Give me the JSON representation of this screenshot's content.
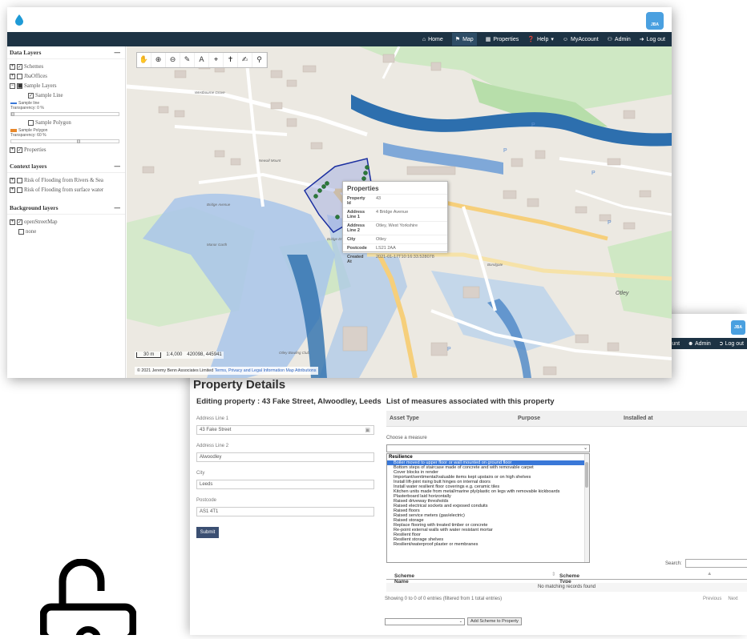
{
  "colors": {
    "navbar": "#1d3344",
    "accent": "#4aa0e0",
    "river": "#2d6fae",
    "flood": "#7fa8d8",
    "polygon": "#1b2fa0",
    "point": "#2b7a3a"
  },
  "map_window": {
    "nav": [
      {
        "icon": "home-icon",
        "label": "Home"
      },
      {
        "icon": "map-icon",
        "label": "Map"
      },
      {
        "icon": "grid-icon",
        "label": "Properties"
      },
      {
        "icon": "help-icon",
        "label": "Help"
      },
      {
        "icon": "user-icon",
        "label": "MyAccount"
      },
      {
        "icon": "admin-icon",
        "label": "Admin"
      },
      {
        "icon": "logout-icon",
        "label": "Log out"
      }
    ],
    "sidebar": {
      "data_layers": {
        "title": "Data Layers",
        "items": [
          "Schemes",
          "JbaOffices",
          "Sample Layers",
          "Sample Line",
          "Sample line",
          "Transparency: 0 %",
          "Sample Polygon",
          "Sample Polygon",
          "Transparency: 60 %",
          "Properties"
        ]
      },
      "context_layers": {
        "title": "Context layers",
        "items": [
          "Risk of Flooding from Rivers & Sea",
          "Risk of Flooding from surface water"
        ]
      },
      "background_layers": {
        "title": "Background layers",
        "items": [
          "openStreetMap",
          "none"
        ]
      }
    },
    "popup": {
      "title": "Properties",
      "rows": [
        {
          "key": "Property Id",
          "value": "43"
        },
        {
          "key": "Address Line 1",
          "value": "4 Bridge Avenue"
        },
        {
          "key": "Address Line 2",
          "value": "Otley, West Yorkshire"
        },
        {
          "key": "City",
          "value": "Otley"
        },
        {
          "key": "Postcode",
          "value": "LS21 2AA"
        },
        {
          "key": "Created At",
          "value": "2021-01-17T10:16:33.528078"
        }
      ]
    },
    "scale": {
      "distance": "30 m",
      "ratio": "1:4,000",
      "coords": "420098, 445941"
    },
    "attribution": {
      "prefix": "© 2021 Jeremy Benn Associates Limited",
      "links": [
        "Terms, Privacy and Legal Information",
        "Map Attributions"
      ]
    },
    "map_labels": [
      "Westbourne Grove",
      "Newall Mount",
      "Bridge Avenue",
      "Bridge End",
      "Manor Garth",
      "Otley Bowling Club",
      "Otley",
      "Bondgate"
    ]
  },
  "details_window": {
    "nav": [
      "ount",
      "Admin",
      "Log out"
    ],
    "page_title": "Property Details",
    "edit_title": "Editing property : 43 Fake Street, Alwoodley, Leeds",
    "form": {
      "address1_label": "Address Line 1",
      "address1": "43 Fake Street",
      "address2_label": "Address Line 2",
      "address2": "Alwoodley",
      "city_label": "City",
      "city": "Leeds",
      "postcode_label": "Postcode",
      "postcode": "AS1 4T1",
      "submit": "Submit"
    },
    "measures": {
      "title": "List of measures associated with this property",
      "columns": [
        "Asset Type",
        "Purpose",
        "Installed at"
      ],
      "choose_label": "Choose a measure",
      "group": "Resilience",
      "options": [
        "Boiler moved to upper floor or wall mounted on ground floor",
        "Bottom steps of staircase made of concrete and with removable carpet",
        "Cover blocks in render",
        "Important/sentimental/valuable items kept upstairs or on high shelves",
        "Install lift-joint rising butt hinges on internal doors",
        "Install water resilient floor coverings e.g. ceramic tiles",
        "Kitchen units made from metal/marine ply/plastic on legs with removable kickboards",
        "Plasterboard laid horizontally",
        "Raised driveway thresholds",
        "Raised electrical sockets and exposed conduits",
        "Raised floors",
        "Raised service meters (gas/electric)",
        "Raised storage",
        "Replace flooring with treated timber or concrete",
        "Re-point external walls with water resistant mortar",
        "Resilient floor",
        "Resilient storage shelves",
        "Resilient/waterproof plaster or membranes"
      ]
    },
    "schemes": {
      "search_label": "Search:",
      "columns": [
        "Scheme Name",
        "Scheme Type"
      ],
      "empty": "No matching records found",
      "showing": "Showing 0 to 0 of 0 entries (filtered from 1 total entries)",
      "previous": "Previous",
      "next": "Next",
      "add_button": "Add Scheme to Property"
    }
  }
}
